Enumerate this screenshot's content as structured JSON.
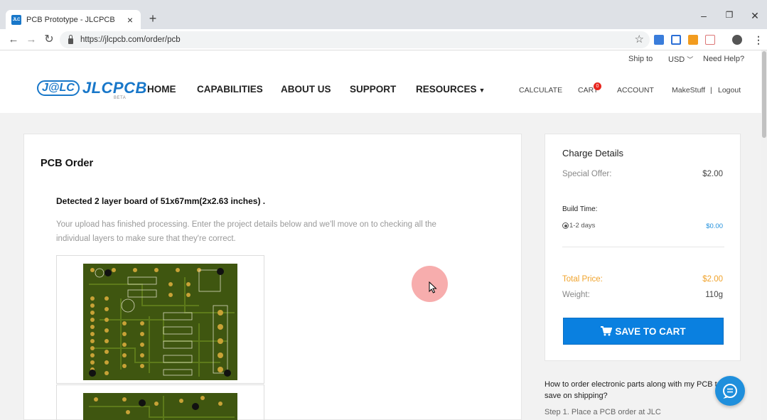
{
  "browser": {
    "tab_title": "PCB Prototype - JLCPCB",
    "favicon_text": "JLC",
    "url": "https://jlcpcb.com/order/pcb",
    "icons": [
      "back-arrow-icon",
      "forward-arrow-icon",
      "reload-icon",
      "lock-icon",
      "star-icon",
      "kebab-menu-icon"
    ]
  },
  "header": {
    "ship_to": "Ship to",
    "currency": "USD",
    "help": "Need Help?",
    "logo_badge": "J@LC",
    "logo_text": "JLCPCB",
    "logo_beta": "BETA",
    "nav": {
      "home": "HOME",
      "capabilities": "CAPABILITIES",
      "about": "ABOUT US",
      "support": "SUPPORT",
      "resources": "RESOURCES"
    },
    "calculate": "CALCULATE",
    "cart": "CART",
    "cart_count": "0",
    "account": "ACCOUNT",
    "user": "MakeStuff",
    "separator": "|",
    "logout": "Logout"
  },
  "order": {
    "heading": "PCB Order",
    "detected": "Detected 2 layer board of 51x67mm(2x2.63 inches) .",
    "message": "Your upload has finished processing. Enter the project details below and we'll move on to checking all the individual layers to make sure that they're correct."
  },
  "charge": {
    "title": "Charge Details",
    "special_offer_label": "Special Offer:",
    "special_offer_value": "$2.00",
    "build_time_label": "Build Time:",
    "build_time_option": "1-2 days",
    "build_time_price": "$0.00",
    "total_label": "Total Price:",
    "total_value": "$2.00",
    "weight_label": "Weight:",
    "weight_value": "110g",
    "save_button": "SAVE TO CART"
  },
  "faq": {
    "question": "How to order electronic parts along with my PCB to save on shipping?",
    "step1": "Step 1. Place a PCB order at JLC"
  },
  "colors": {
    "brand_blue": "#1877c9",
    "button_blue": "#0a80e0",
    "total_orange": "#f0a32c",
    "pcb_green": "#3f5610"
  }
}
